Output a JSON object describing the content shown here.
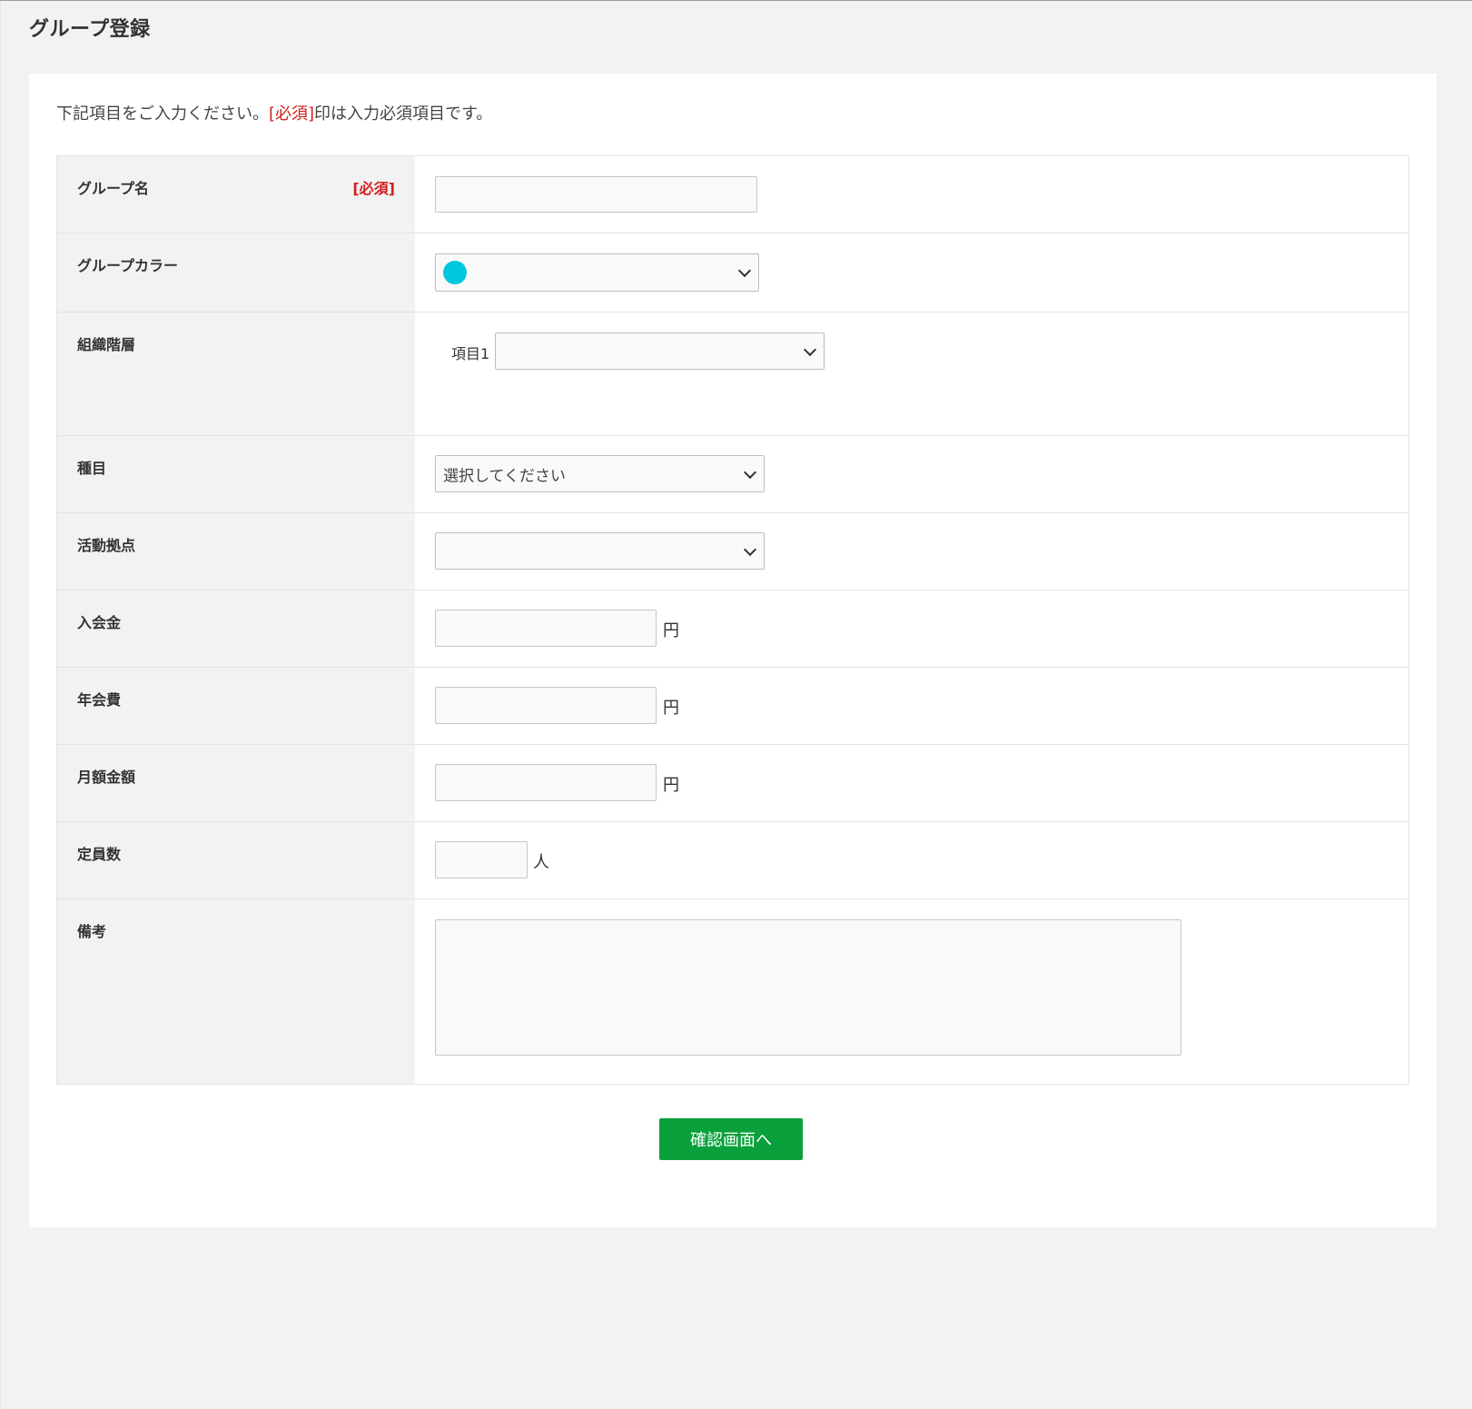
{
  "page": {
    "title": "グループ登録",
    "intro_before": "下記項目をご入力ください。",
    "intro_required": "[必須]",
    "intro_after": "印は入力必須項目です。",
    "submit_label": "確認画面へ"
  },
  "colors": {
    "required": "#d21f1f",
    "submit": "#0aa03b",
    "group_color_dot": "#00c8dc"
  },
  "form": {
    "group_name": {
      "label": "グループ名",
      "required": "[必須]",
      "value": ""
    },
    "group_color": {
      "label": "グループカラー",
      "selected_color": "#00c8dc"
    },
    "organization": {
      "label": "組織階層",
      "item_label": "項目1",
      "value": ""
    },
    "category": {
      "label": "種目",
      "placeholder": "選択してください"
    },
    "base": {
      "label": "活動拠点",
      "value": ""
    },
    "entry_fee": {
      "label": "入会金",
      "value": "",
      "unit": "円"
    },
    "annual_fee": {
      "label": "年会費",
      "value": "",
      "unit": "円"
    },
    "monthly_fee": {
      "label": "月額金額",
      "value": "",
      "unit": "円"
    },
    "capacity": {
      "label": "定員数",
      "value": "",
      "unit": "人"
    },
    "notes": {
      "label": "備考",
      "value": ""
    }
  }
}
